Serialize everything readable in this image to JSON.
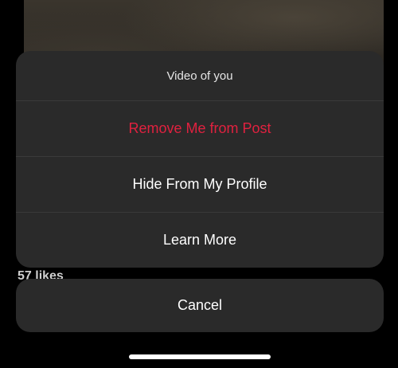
{
  "post": {
    "likes_text": "57 likes"
  },
  "action_sheet": {
    "title": "Video of you",
    "items": [
      {
        "label": "Remove Me from Post",
        "style": "destructive",
        "color": "#e0213f"
      },
      {
        "label": "Hide From My Profile",
        "style": "default"
      },
      {
        "label": "Learn More",
        "style": "default"
      }
    ],
    "cancel_label": "Cancel"
  },
  "colors": {
    "sheet_background": "#2a2a2a",
    "destructive": "#e0213f",
    "text": "#ffffff"
  }
}
